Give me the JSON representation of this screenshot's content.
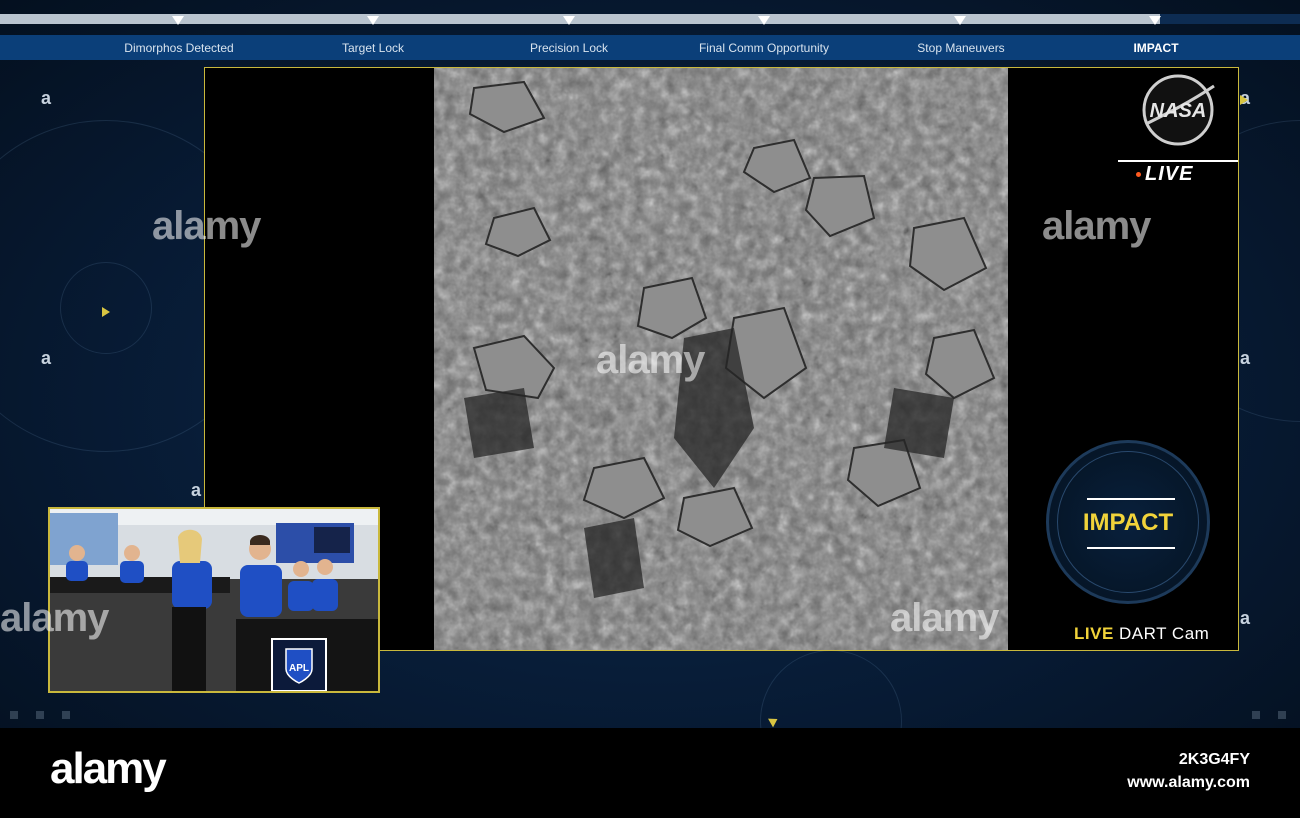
{
  "timeline": {
    "milestones": [
      {
        "label": "Dimorphos Detected",
        "active": false
      },
      {
        "label": "Target Lock",
        "active": false
      },
      {
        "label": "Precision Lock",
        "active": false
      },
      {
        "label": "Final Comm Opportunity",
        "active": false
      },
      {
        "label": "Stop Maneuvers",
        "active": false
      },
      {
        "label": "IMPACT",
        "active": true
      }
    ]
  },
  "broadcast": {
    "brand": "NASA",
    "live_badge": "LIVE",
    "status": "IMPACT",
    "camera_caption_live": "LIVE",
    "camera_caption_name": "DART Cam"
  },
  "decor": {
    "corner_glyph": "a"
  },
  "watermark": {
    "text": "alamy",
    "image_id": "2K3G4FY",
    "url": "www.alamy.com"
  },
  "colors": {
    "accent_yellow": "#f1d33a",
    "panel_border": "#c9b83c",
    "timeline_band": "#0b3f79",
    "background_navy": "#071a33",
    "team_shirt_blue": "#1f4fc4",
    "live_dot": "#ff5a1f"
  },
  "inset": {
    "logo": "APL"
  }
}
